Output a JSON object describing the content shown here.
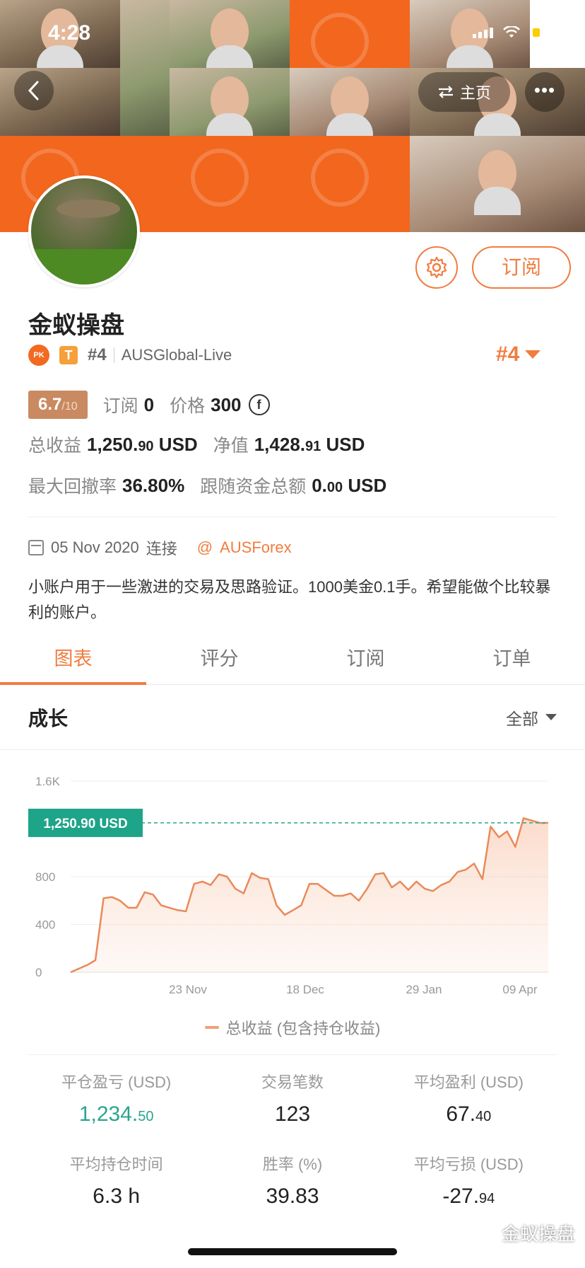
{
  "status_bar": {
    "time": "4:28"
  },
  "header": {
    "back_icon": "chevron-left-icon",
    "home_label": "主页",
    "home_icon": "swap-arrows-icon",
    "more_label": "•••"
  },
  "profile": {
    "name": "金蚁操盘",
    "pk_label": "PK",
    "t_badge": "T",
    "rank_small": "#4",
    "server": "AUSGlobal-Live",
    "rank_big": "#4",
    "subscribe_label": "订阅",
    "score": "6.7",
    "score_max": "/10",
    "subscriptions_label": "订阅",
    "subscriptions_value": "0",
    "price_label": "价格",
    "price_value": "300",
    "coin_symbol": "f",
    "total_profit_label": "总收益",
    "total_profit_int": "1,250.",
    "total_profit_dec": "90",
    "total_profit_unit": "USD",
    "equity_label": "净值",
    "equity_int": "1,428.",
    "equity_dec": "91",
    "equity_unit": "USD",
    "max_drawdown_label": "最大回撤率",
    "max_drawdown_value": "36.80%",
    "follow_funds_label": "跟随资金总额",
    "follow_funds_int": "0.",
    "follow_funds_dec": "00",
    "follow_funds_unit": "USD",
    "connect_date": "05 Nov 2020",
    "connect_label": "连接",
    "at_symbol": "@",
    "handle": "AUSForex",
    "description": "小账户用于一些激进的交易及思路验证。1000美金0.1手。希望能做个比较暴利的账户。"
  },
  "tabs": [
    {
      "label": "图表",
      "active": true
    },
    {
      "label": "评分",
      "active": false
    },
    {
      "label": "订阅",
      "active": false
    },
    {
      "label": "订单",
      "active": false
    }
  ],
  "section": {
    "title": "成长",
    "filter": "全部"
  },
  "chart_data": {
    "type": "area",
    "title": "",
    "xlabel": "",
    "ylabel": "",
    "ylim": [
      0,
      1600
    ],
    "yticks": [
      "0",
      "400",
      "800",
      "1.6K"
    ],
    "yticks_values": [
      0,
      400,
      800,
      1600
    ],
    "xticks": [
      "23 Nov",
      "18 Dec",
      "29 Jan",
      "09 Apr"
    ],
    "current_label": "1,250.90 USD",
    "current_value": 1250.9,
    "series": [
      {
        "name": "总收益 (包含持仓收益)",
        "color": "#e98a5a",
        "values": [
          0,
          30,
          60,
          100,
          620,
          630,
          600,
          540,
          540,
          670,
          650,
          560,
          540,
          520,
          510,
          740,
          760,
          730,
          820,
          800,
          700,
          660,
          830,
          790,
          780,
          560,
          480,
          520,
          560,
          740,
          740,
          690,
          640,
          640,
          660,
          600,
          700,
          820,
          830,
          710,
          760,
          690,
          760,
          700,
          680,
          730,
          760,
          840,
          860,
          910,
          780,
          1220,
          1130,
          1180,
          1050,
          1290,
          1270,
          1250,
          1250.9
        ]
      }
    ]
  },
  "legend": {
    "label": "总收益 (包含持仓收益)"
  },
  "stats": [
    {
      "label": "平仓盈亏 (USD)",
      "int": "1,234.",
      "dec": "50",
      "green": true
    },
    {
      "label": "交易笔数",
      "int": "123",
      "dec": "",
      "green": false
    },
    {
      "label": "平均盈利 (USD)",
      "int": "67.",
      "dec": "40",
      "green": false
    },
    {
      "label": "平均持仓时间",
      "int": "6.3 h",
      "dec": "",
      "green": false
    },
    {
      "label": "胜率 (%)",
      "int": "39.83",
      "dec": "",
      "green": false
    },
    {
      "label": "平均亏损 (USD)",
      "int": "-27.",
      "dec": "94",
      "green": false
    }
  ],
  "watermark": "金蚁操盘",
  "colors": {
    "accent": "#f07d3f",
    "green": "#2aa58e",
    "chart_line": "#e98a5a"
  }
}
